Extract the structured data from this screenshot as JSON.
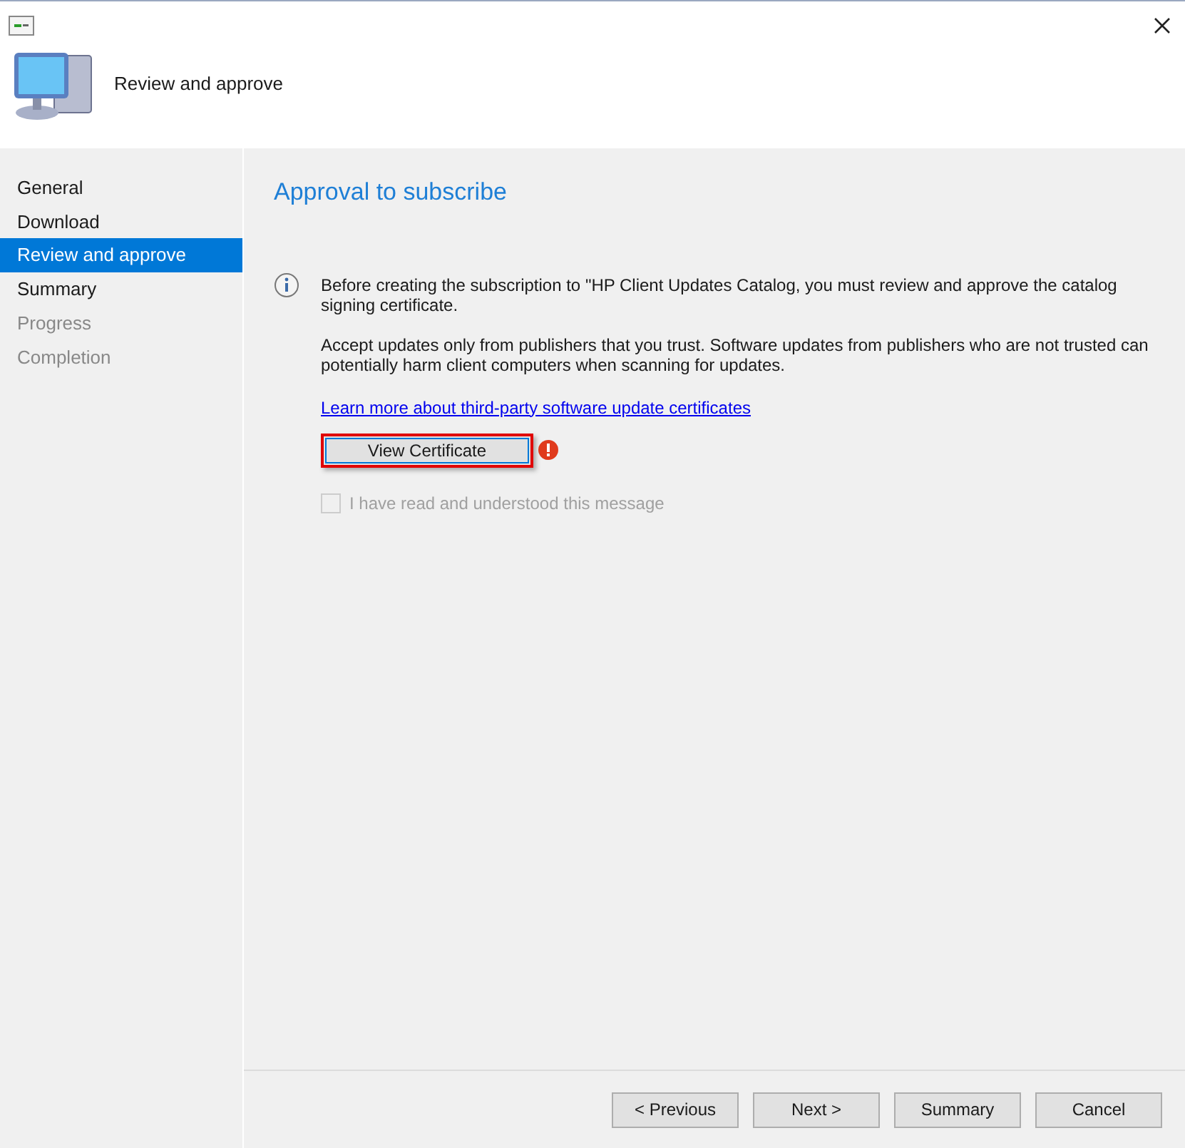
{
  "header": {
    "title": "Review and approve"
  },
  "sidebar": {
    "items": [
      {
        "label": "General",
        "selected": false,
        "disabled": false
      },
      {
        "label": "Download",
        "selected": false,
        "disabled": false
      },
      {
        "label": "Review and approve",
        "selected": true,
        "disabled": false
      },
      {
        "label": "Summary",
        "selected": false,
        "disabled": false
      },
      {
        "label": "Progress",
        "selected": false,
        "disabled": true
      },
      {
        "label": "Completion",
        "selected": false,
        "disabled": true
      }
    ]
  },
  "page": {
    "heading": "Approval to subscribe",
    "info": "Before creating the subscription to \"HP Client Updates Catalog, you must review and approve the catalog signing certificate.",
    "warning_text": "Accept updates only from publishers that you trust. Software updates from publishers who are not trusted can potentially harm client computers when scanning for updates.",
    "link": "Learn more about third-party software update certificates",
    "certificate_button": {
      "label": "View Certificate",
      "highlighted": true,
      "error": true
    },
    "confirm": {
      "label": "I have read and understood this message",
      "checked": false,
      "disabled": true
    }
  },
  "buttons": [
    {
      "label": "< Previous",
      "disabled": false
    },
    {
      "label": "Next >",
      "disabled": false
    },
    {
      "label": "Summary",
      "disabled": false
    },
    {
      "label": "Cancel",
      "disabled": false
    }
  ]
}
